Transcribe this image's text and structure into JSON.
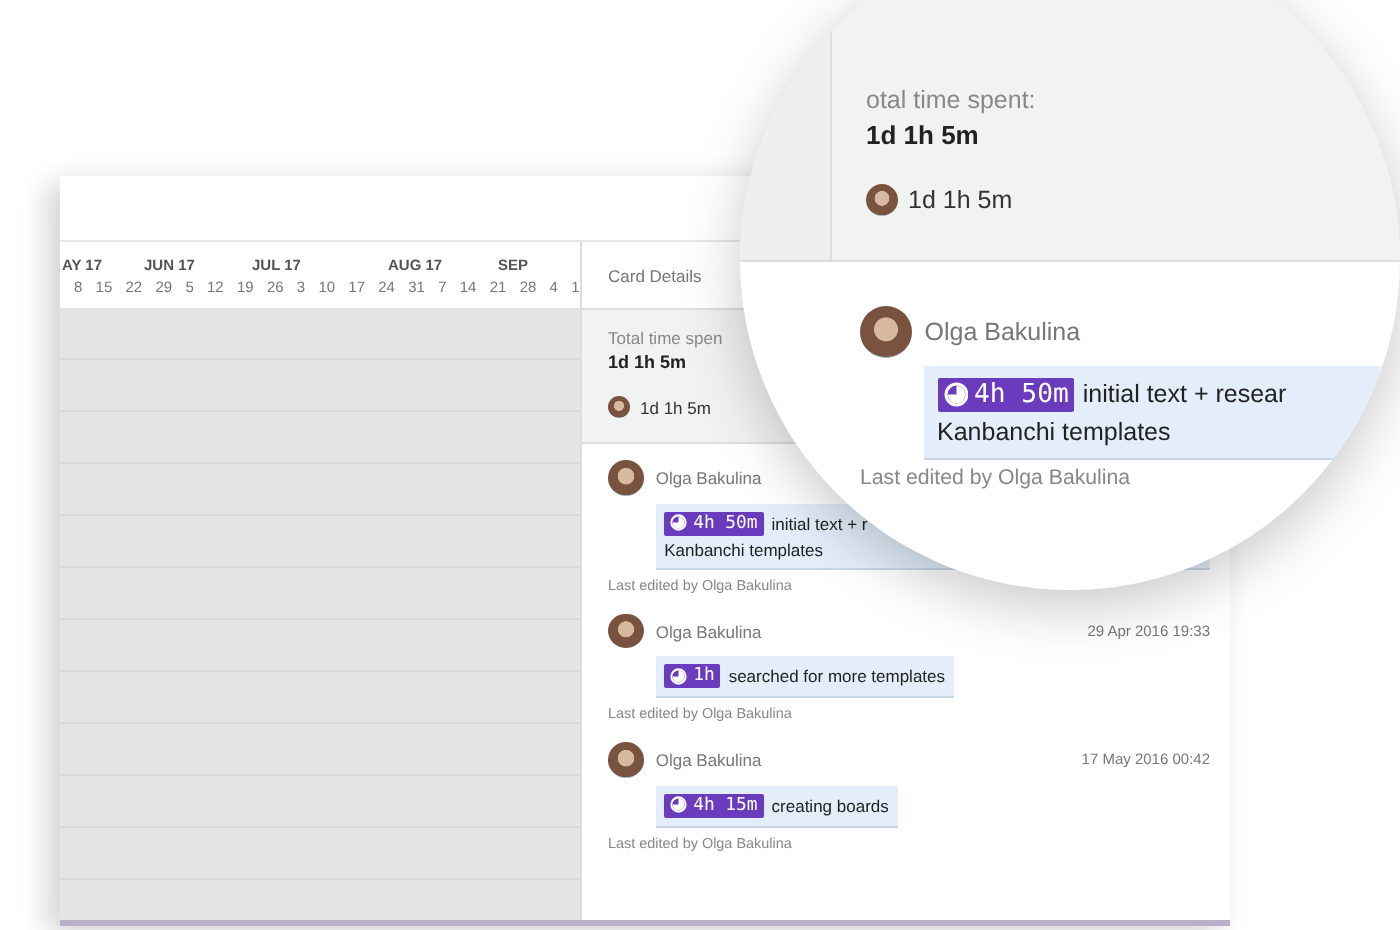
{
  "timeline": {
    "months": [
      "AY 17",
      "JUN 17",
      "JUL 17",
      "AUG 17",
      "SEP"
    ],
    "weeks": [
      "8",
      "15",
      "22",
      "29",
      "5",
      "12",
      "19",
      "26",
      "3",
      "10",
      "17",
      "24",
      "31",
      "7",
      "14",
      "21",
      "28",
      "4",
      "1"
    ]
  },
  "card_details": {
    "title": "Card Details",
    "total_label": "Total time spen",
    "total": "1d 1h 5m",
    "users": [
      {
        "time": "1d 1h 5m"
      }
    ],
    "entries": [
      {
        "author": "Olga Bakulina",
        "duration": "4h 50m",
        "lines": [
          "initial text + r",
          "Kanbanchi templates"
        ],
        "edited": "Last edited by Olga Bakulina"
      },
      {
        "author": "Olga Bakulina",
        "date": "29 Apr 2016 19:33",
        "duration": "1h",
        "lines": [
          "searched for more templates"
        ],
        "edited": "Last edited by Olga Bakulina"
      },
      {
        "author": "Olga Bakulina",
        "date": "17 May 2016 00:42",
        "duration": "4h 15m",
        "lines": [
          "creating boards"
        ],
        "edited": "Last edited by Olga Bakulina"
      }
    ]
  },
  "magnifier": {
    "total_label": "otal time spent:",
    "total": "1d 1h 5m",
    "users": [
      {
        "time": "1d 1h 5m"
      }
    ],
    "entry": {
      "author": "Olga Bakulina",
      "duration": "4h 50m",
      "lines": [
        "initial text + resear",
        "Kanbanchi templates"
      ],
      "edited": "Last edited by Olga Bakulina"
    }
  }
}
